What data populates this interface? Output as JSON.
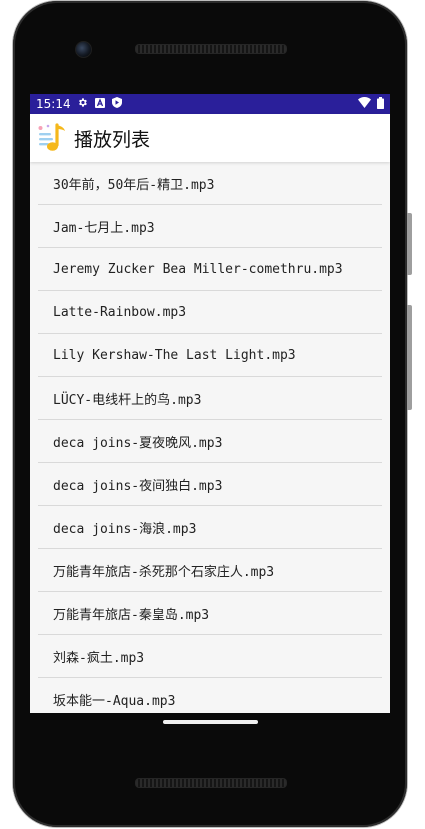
{
  "status_bar": {
    "time": "15:14",
    "icons_left": [
      "settings-icon",
      "a-icon",
      "shield-icon"
    ],
    "icons_right": [
      "wifi-icon",
      "battery-icon"
    ],
    "background_color": "#2a1f9a"
  },
  "app_bar": {
    "title": "播放列表",
    "logo_icon": "music-note-icon"
  },
  "playlist": {
    "items": [
      "30年前，50年后-精卫.mp3",
      "Jam-七月上.mp3",
      "Jeremy Zucker Bea Miller-comethru.mp3",
      "Latte-Rainbow.mp3",
      "Lily Kershaw-The Last Light.mp3",
      "LÜCY-电线杆上的鸟.mp3",
      "deca joins-夏夜晚风.mp3",
      "deca joins-夜间独白.mp3",
      "deca joins-海浪.mp3",
      "万能青年旅店-杀死那个石家庄人.mp3",
      "万能青年旅店-秦皇岛.mp3",
      "刘森-疯土.mp3",
      "坂本能一-Aqua.mp3"
    ]
  }
}
